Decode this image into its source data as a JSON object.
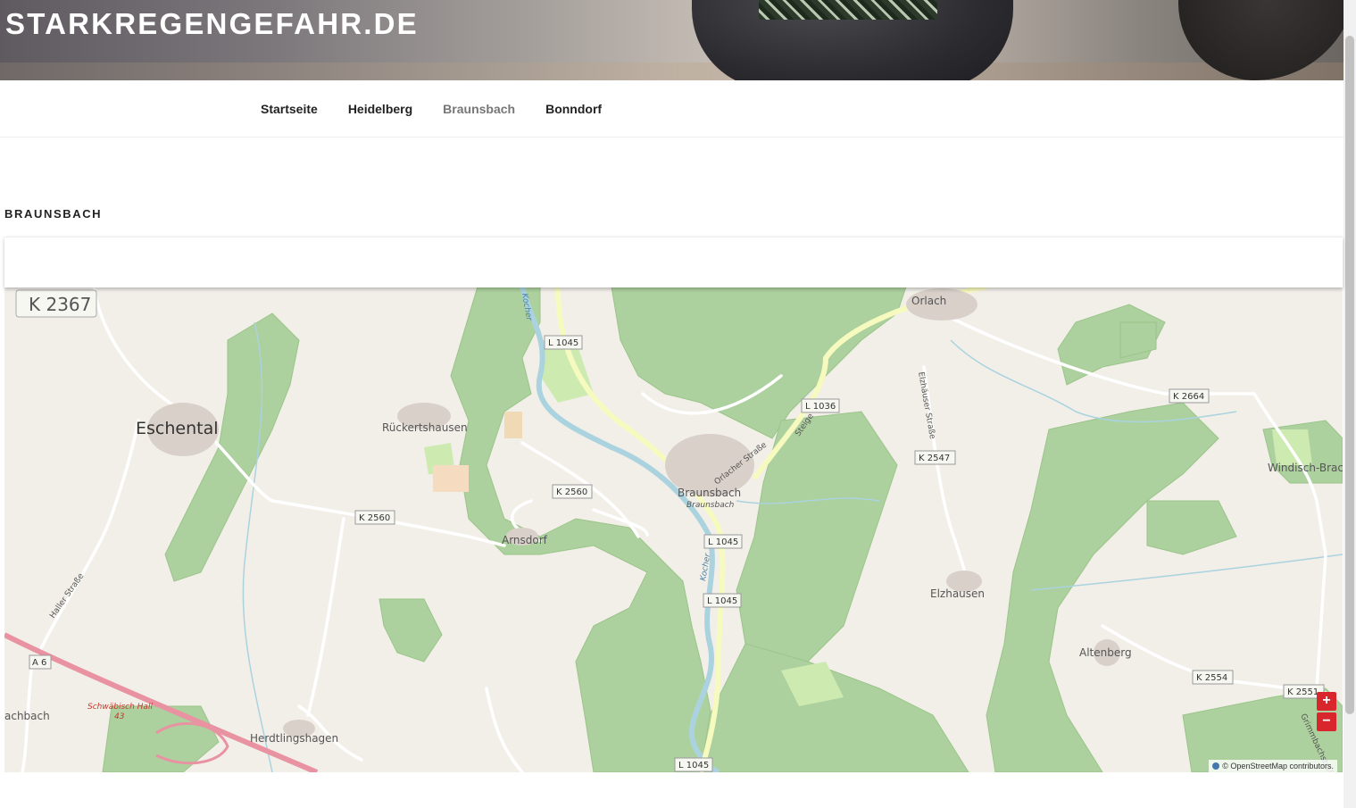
{
  "header": {
    "site_title": "STARKREGENGEFAHR.DE"
  },
  "nav": {
    "items": [
      {
        "label": "Startseite"
      },
      {
        "label": "Heidelberg"
      },
      {
        "label": "Braunsbach",
        "current": true
      },
      {
        "label": "Bonndorf"
      }
    ]
  },
  "page": {
    "title": "BRAUNSBACH"
  },
  "map": {
    "places": [
      {
        "name": "Eschental",
        "size": "large"
      },
      {
        "name": "Rückertshausen"
      },
      {
        "name": "Arnsdorf"
      },
      {
        "name": "Braunsbach"
      },
      {
        "name": "Braunsbach",
        "style": "italic"
      },
      {
        "name": "Orlach"
      },
      {
        "name": "Elzhausen"
      },
      {
        "name": "Altenberg"
      },
      {
        "name": "Windisch-Brac"
      },
      {
        "name": "Herdtlingshagen"
      },
      {
        "name": "achbach"
      },
      {
        "name": "Schwäbisch Hall\n43",
        "style": "motorway-exit"
      }
    ],
    "roads": [
      {
        "label": "K 2367",
        "type": "big-shield"
      },
      {
        "label": "L 1045"
      },
      {
        "label": "L 1036"
      },
      {
        "label": "K 2664"
      },
      {
        "label": "K 2547"
      },
      {
        "label": "K 2560"
      },
      {
        "label": "K 2560"
      },
      {
        "label": "L 1045"
      },
      {
        "label": "L 1045"
      },
      {
        "label": "A 6"
      },
      {
        "label": "K 2554"
      },
      {
        "label": "K 2551"
      },
      {
        "label": "L 1045"
      }
    ],
    "street_names": [
      "Haller Straße",
      "Orlacher Straße",
      "Steige",
      "Elzhäuser Straße",
      "Kocher",
      "Kocher",
      "Grimmbachstraße"
    ],
    "zoom_in": "+",
    "zoom_out": "−",
    "attribution": "© OpenStreetMap contributors."
  }
}
